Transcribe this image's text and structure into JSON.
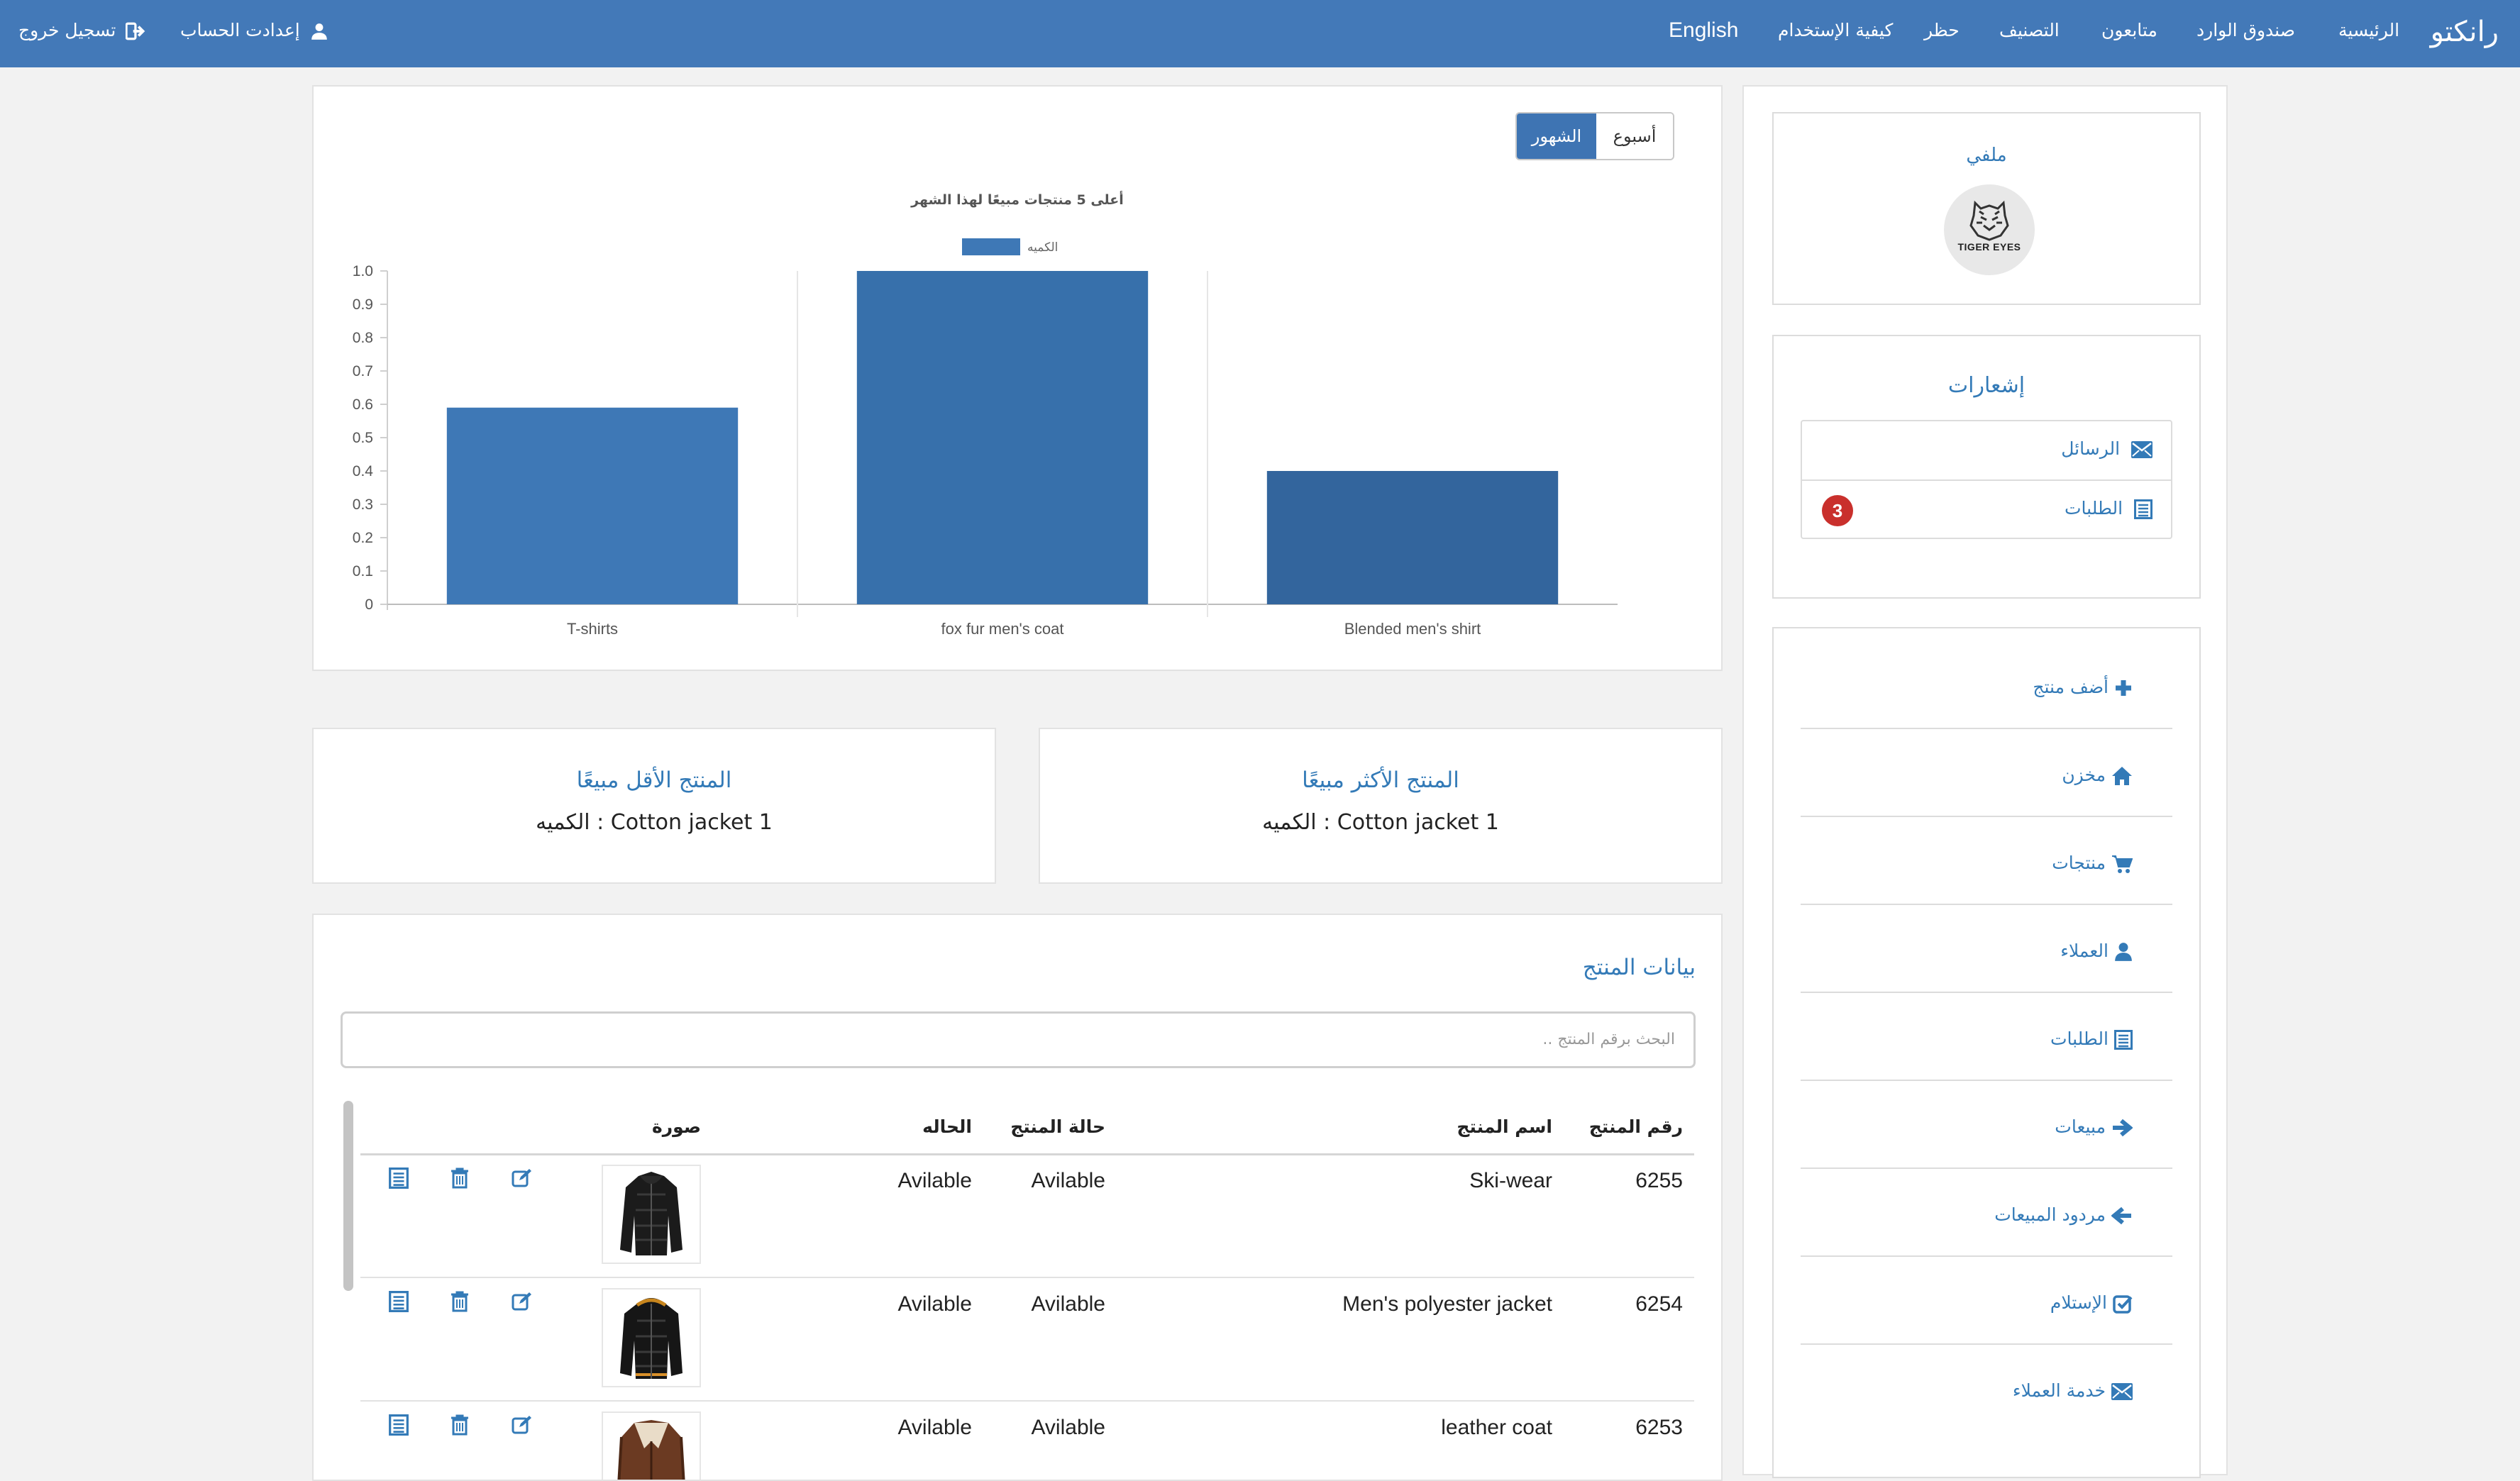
{
  "navbar": {
    "brand": "رانكتو",
    "items": [
      "الرئيسية",
      "صندوق الوارد",
      "متابعون",
      "التصنيف",
      "حظر",
      "كيفية الإستخدام"
    ],
    "language": "English",
    "account_settings": "إعدادت الحساب",
    "logout": "تسجيل خروج"
  },
  "profile": {
    "title": "ملفي",
    "avatar_text": "TIGER EYES"
  },
  "notifications": {
    "title": "إشعارات",
    "messages": "الرسائل",
    "orders": "الطلبات",
    "orders_badge": "3"
  },
  "menu": {
    "items": [
      "أضف منتج",
      "مخزن",
      "منتجات",
      "العملاء",
      "الطلبات",
      "مبيعات",
      "مردود المبيعات",
      "الإستلام",
      "خدمة العملاء"
    ]
  },
  "chart_toggle": {
    "week": "أسبوع",
    "month": "الشهور",
    "active": "month"
  },
  "chart_data": {
    "type": "bar",
    "title": "أعلى 5 منتجات مبيعًا لهذا الشهر",
    "categories": [
      "T-shirts",
      "fox fur men's coat",
      "Blended men's shirt"
    ],
    "series": [
      {
        "name": "الكميه",
        "values": [
          0.59,
          1.0,
          0.4
        ]
      }
    ],
    "ylim": [
      0,
      1.0
    ],
    "yticks": [
      "0",
      "0.1",
      "0.2",
      "0.3",
      "0.4",
      "0.5",
      "0.6",
      "0.7",
      "0.8",
      "0.9",
      "1.0"
    ],
    "legend": "top",
    "colors": [
      "#3e78b6",
      "#3770ab",
      "#33659d"
    ]
  },
  "stats": {
    "best_title": "المنتج الأكثر مبيعًا",
    "best_value": "الكميه : Cotton jacket 1",
    "least_title": "المنتج الأقل مبيعًا",
    "least_value": "الكميه : Cotton jacket 1"
  },
  "products": {
    "title": "بيانات المنتج",
    "search_placeholder": "البحث برقم المنتج ..",
    "columns": [
      "رقم المنتج",
      "اسم المنتج",
      "حالة المنتج",
      "الحاله",
      "صورة"
    ],
    "rows": [
      {
        "id": "6255",
        "name": "Ski-wear",
        "product_status": "Avilable",
        "status": "Avilable"
      },
      {
        "id": "6254",
        "name": "Men's polyester jacket",
        "product_status": "Avilable",
        "status": "Avilable"
      },
      {
        "id": "6253",
        "name": "leather coat",
        "product_status": "Avilable",
        "status": "Avilable"
      }
    ]
  }
}
